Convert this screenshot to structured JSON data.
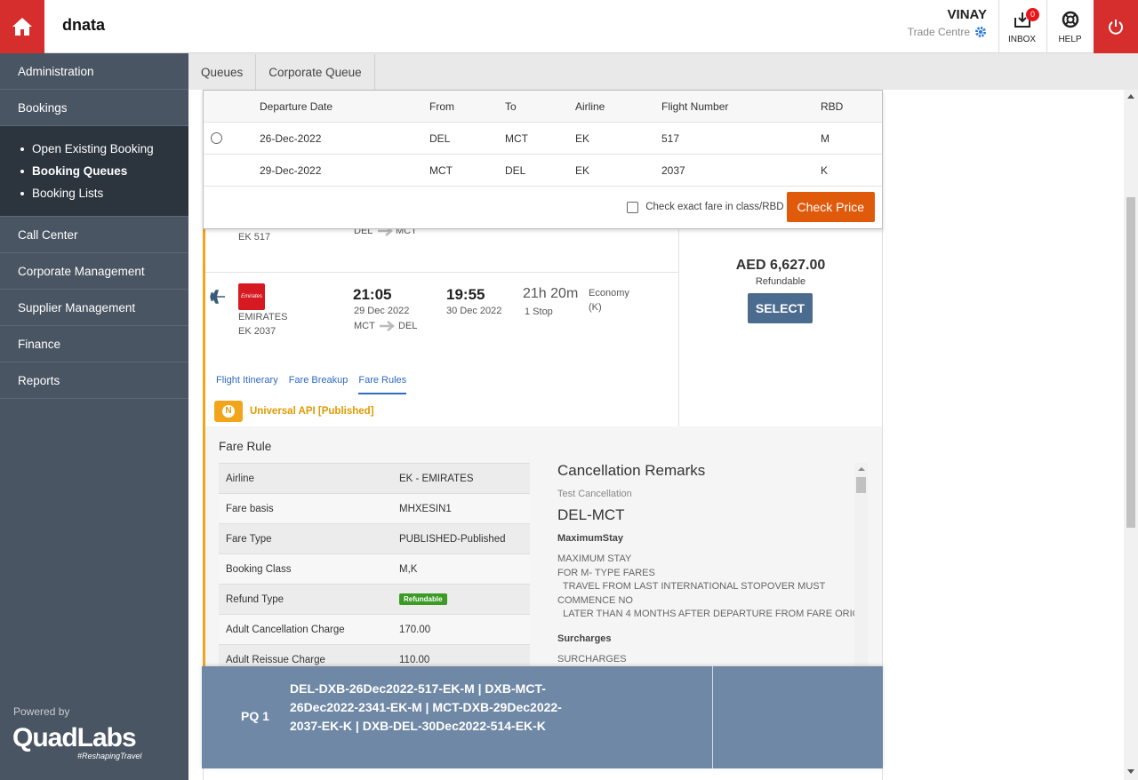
{
  "header": {
    "brand": "dnata",
    "user_name": "VINAY",
    "user_location": "Trade Centre",
    "inbox_label": "INBOX",
    "inbox_count": "0",
    "help_label": "HELP"
  },
  "sidebar": {
    "items_top": [
      {
        "label": "Administration"
      },
      {
        "label": "Bookings"
      }
    ],
    "sub_items": [
      {
        "label": "Open Existing Booking"
      },
      {
        "label": "Booking Queues"
      },
      {
        "label": "Booking Lists"
      }
    ],
    "items_bottom": [
      {
        "label": "Call Center"
      },
      {
        "label": "Corporate Management"
      },
      {
        "label": "Supplier Management"
      },
      {
        "label": "Finance"
      },
      {
        "label": "Reports"
      }
    ],
    "powered_by": "Powered by",
    "logo_text": "QuadLabs",
    "logo_tag": "#ReshapingTravel"
  },
  "tabs": [
    "Queues",
    "Corporate Queue"
  ],
  "flight_table": {
    "headers": [
      "Departure Date",
      "From",
      "To",
      "Airline",
      "Flight Number",
      "RBD"
    ],
    "rows": [
      [
        "26-Dec-2022",
        "DEL",
        "MCT",
        "EK",
        "517",
        "M"
      ],
      [
        "29-Dec-2022",
        "MCT",
        "DEL",
        "EK",
        "2037",
        "K"
      ]
    ],
    "exact_fare_label": "Check exact fare in class/RBD",
    "check_price": "Check Price"
  },
  "segment_partial": {
    "flight": "EK  517",
    "route_from": "DEL",
    "route_to": "MCT"
  },
  "segment_return": {
    "airline": "EMIRATES",
    "logo_text": "Emirates",
    "flight": "EK  2037",
    "dep_time": "21:05",
    "dep_date": "29 Dec 2022",
    "arr_time": "19:55",
    "arr_date": "30 Dec 2022",
    "duration": "21h 20m",
    "stops": "1 Stop",
    "cabin": "Economy",
    "class": "(K)",
    "route_from": "MCT",
    "route_to": "DEL"
  },
  "price": {
    "amount": "AED 6,627.00",
    "refund_status": "Refundable",
    "select_label": "SELECT"
  },
  "detail_tabs": [
    "Flight Itinerary",
    "Fare Breakup",
    "Fare Rules"
  ],
  "supplier": "Universal API [Published]",
  "supplier_icon_letter": "N",
  "fare_rule": {
    "title": "Fare Rule",
    "rows": [
      {
        "key": "Airline",
        "value": "EK - EMIRATES"
      },
      {
        "key": "Fare basis",
        "value": "MHXESIN1"
      },
      {
        "key": "Fare Type",
        "value": "PUBLISHED-Published"
      },
      {
        "key": "Booking Class",
        "value": "M,K"
      },
      {
        "key": "Refund Type",
        "value": "Refundable"
      },
      {
        "key": "Adult Cancellation Charge",
        "value": "170.00"
      },
      {
        "key": "Adult Reissue Charge",
        "value": "110.00"
      }
    ]
  },
  "remarks": {
    "title": "Cancellation Remarks",
    "subtitle": "Test Cancellation",
    "route": "DEL-MCT",
    "heading1": "MaximumStay",
    "body1": "MAXIMUM STAY\nFOR M- TYPE FARES\n  TRAVEL FROM LAST INTERNATIONAL STOPOVER MUST\nCOMMENCE NO\n  LATER THAN 4 MONTHS AFTER DEPARTURE FROM FARE ORIGIN.",
    "heading2": "Surcharges",
    "body2": "SURCHARGES"
  },
  "pq": {
    "label": "PQ 1",
    "text": "DEL-DXB-26Dec2022-517-EK-M | DXB-MCT-26Dec2022-2341-EK-M | MCT-DXB-29Dec2022-2037-EK-K | DXB-DEL-30Dec2022-514-EK-K"
  },
  "colors": {
    "header_red": "#d62d2d",
    "sidebar_bg": "#4a5563",
    "check_price_orange": "#e05a0c",
    "select_blue": "#4b6c8f",
    "pq_bg": "#6f88a6",
    "accent_orange": "#f2a51a"
  }
}
